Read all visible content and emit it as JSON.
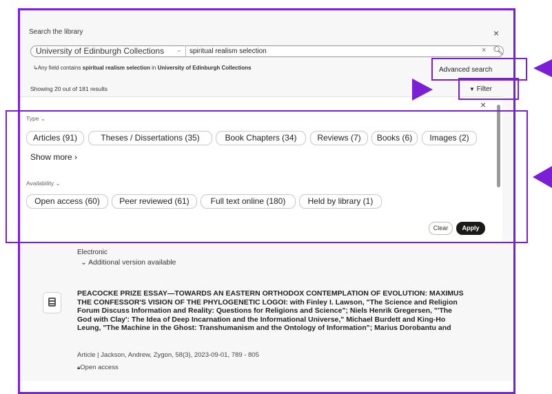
{
  "dialog": {
    "title": "Search the library",
    "close_glyph": "×"
  },
  "search": {
    "scope": "University of Edinburgh Collections",
    "scope_chevron": "⌄",
    "query": "spiritual realism selection",
    "clear_glyph": "×",
    "search_glyph": "🔍︎"
  },
  "summary": {
    "prefix_glyph": "↳",
    "text_1": "Any field contains ",
    "term": "spiritual realism selection",
    "text_2": " in ",
    "collection": "University of Edinburgh Collections"
  },
  "advanced_search_label": "Advanced search",
  "results_count": "Showing 20 out of 181 results",
  "filter_button": {
    "glyph": "▼",
    "label": "Filter"
  },
  "filter_panel": {
    "close_glyph": "×",
    "type": {
      "label": "Type",
      "chevron": "⌄",
      "chips": [
        "Articles (91)",
        "Theses / Dissertations (35)",
        "Book Chapters (34)",
        "Reviews (7)",
        "Books (6)",
        "Images (2)"
      ],
      "show_more": "Show more ›"
    },
    "availability": {
      "label": "Availability",
      "chevron": "⌄",
      "chips": [
        "Open access (60)",
        "Peer reviewed (61)",
        "Full text online (180)",
        "Held by library (1)"
      ]
    },
    "clear_label": "Clear",
    "apply_label": "Apply"
  },
  "results": {
    "previous_tail": {
      "format": "Electronic",
      "additional_version": "⌄ Additional version available"
    },
    "record": {
      "title": "PEACOCKE PRIZE ESSAY—TOWARDS AN EASTERN ORTHODOX CONTEMPLATION OF EVOLUTION: MAXIMUS THE CONFESSOR'S VISION OF THE PHYLOGENETIC LOGOI: with Finley I. Lawson, \"The Science and Religion Forum Discuss Information and Reality: Questions for Religions and Science\"; Niels Henrik Gregersen, \"'The God with Clay': The Idea of Deep Incarnation and the Informational Universe,\" Michael Burdett and King-Ho Leung, \"The Machine in the Ghost: Transhumanism and the Ontology of Information\"; Marius Dorobantu and",
      "meta": "Article | Jackson, Andrew, Zygon, 58(3), 2023-09-01, 789 - 805",
      "access": "Open access",
      "access_glyph": "🔒︎"
    }
  },
  "colors": {
    "annotation": "#7b1fd6",
    "apply_bg": "#1a1a1a",
    "panel_bg": "#ffffff",
    "dialog_bg": "#f7f7f7"
  }
}
